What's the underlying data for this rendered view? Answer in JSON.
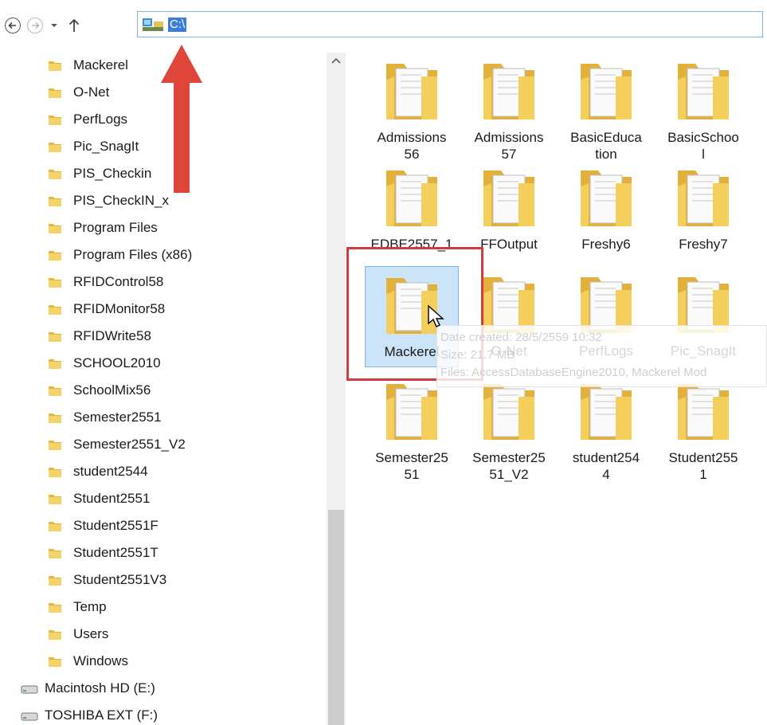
{
  "address_bar": {
    "path": "C:\\"
  },
  "navigation": {
    "back_icon": "back-arrow-icon",
    "forward_icon": "forward-arrow-icon",
    "recent_icon": "chevron-down-icon",
    "up_icon": "up-arrow-icon"
  },
  "tree": {
    "folders": [
      "Mackerel",
      "O-Net",
      "PerfLogs",
      "Pic_SnagIt",
      "PIS_Checkin",
      "PIS_CheckIN_x",
      "Program Files",
      "Program Files (x86)",
      "RFIDControl58",
      "RFIDMonitor58",
      "RFIDWrite58",
      "SCHOOL2010",
      "SchoolMix56",
      "Semester2551",
      "Semester2551_V2",
      "student2544",
      "Student2551",
      "Student2551F",
      "Student2551T",
      "Student2551V3",
      "Temp",
      "Users",
      "Windows"
    ],
    "drives": [
      "Macintosh HD (E:)",
      "TOSHIBA EXT (F:)"
    ]
  },
  "content": {
    "tiles": [
      "Admissions\n56",
      "Admissions\n57",
      "BasicEduca\ntion",
      "BasicSchoo\nl",
      "EDBE2557_1",
      "FFOutput",
      "Freshy6",
      "Freshy7",
      "Mackerel",
      "O-Net",
      "PerfLogs",
      "Pic_SnagIt",
      "Semester25\n51",
      "Semester25\n51_V2",
      "student254\n4",
      "Student255\n1"
    ],
    "selected": "Mackerel"
  },
  "tooltip": {
    "line1": "Date created: 28/5/2559 10:32",
    "line2": "Size: 21.7 MB",
    "line3": "Files: AccessDatabaseEngine2010, Mackerel Mod"
  },
  "colors": {
    "folder": "#f2c94c",
    "selection": "#cce4f7",
    "annotation_red": "#d13b3b",
    "address_highlight": "#3a7fd5"
  }
}
